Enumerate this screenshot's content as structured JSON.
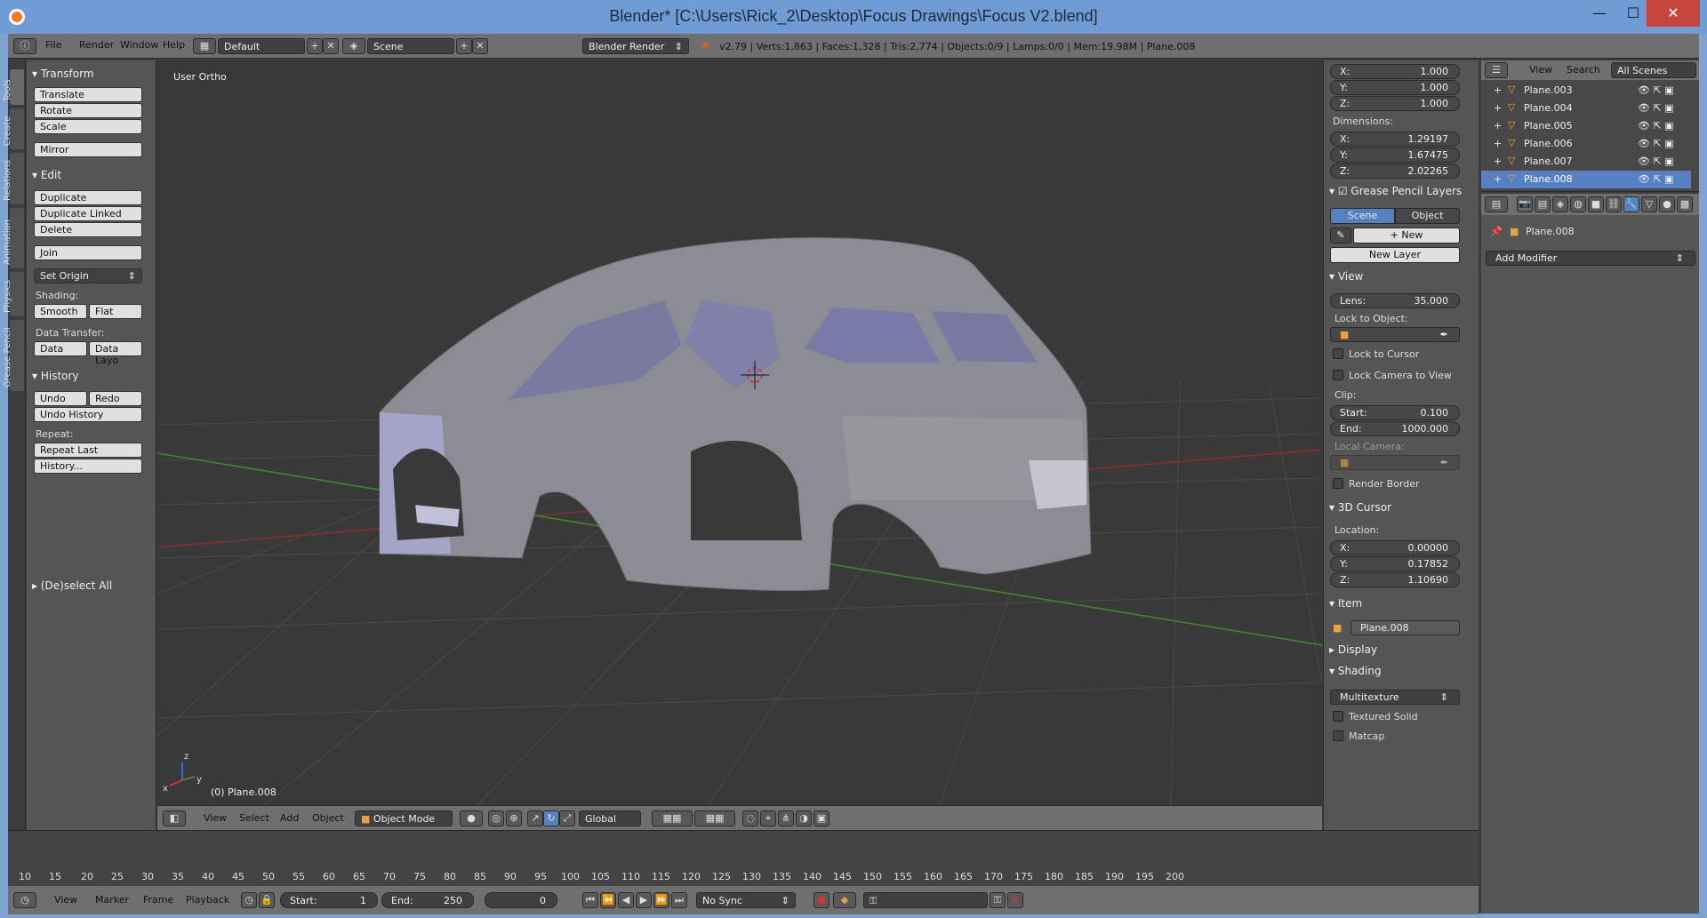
{
  "window": {
    "title": "Blender* [C:\\Users\\Rick_2\\Desktop\\Focus Drawings\\Focus V2.blend]",
    "min_glyph": "—",
    "max_glyph": "☐",
    "close_glyph": "✕"
  },
  "info_header": {
    "menus": [
      "File",
      "Render",
      "Window",
      "Help"
    ],
    "layout": "Default",
    "scene": "Scene",
    "engine": "Blender Render",
    "stats": "v2.79 | Verts:1,863 | Faces:1,328 | Tris:2,774 | Objects:0/9 | Lamps:0/0 | Mem:19.98M | Plane.008"
  },
  "left_tabs": [
    "Tools",
    "Create",
    "Relations",
    "Animation",
    "Physics",
    "Grease Pencil"
  ],
  "tool_shelf": {
    "transform": {
      "title": "Transform",
      "translate": "Translate",
      "rotate": "Rotate",
      "scale": "Scale",
      "mirror": "Mirror"
    },
    "edit": {
      "title": "Edit",
      "duplicate": "Duplicate",
      "duplicate_linked": "Duplicate Linked",
      "delete": "Delete",
      "join": "Join",
      "set_origin": "Set Origin"
    },
    "shading": {
      "label": "Shading:",
      "smooth": "Smooth",
      "flat": "Flat"
    },
    "data_transfer": {
      "label": "Data Transfer:",
      "data": "Data",
      "data_layo": "Data Layo"
    },
    "history": {
      "title": "History",
      "undo": "Undo",
      "redo": "Redo",
      "undo_history": "Undo History",
      "repeat_label": "Repeat:",
      "repeat_last": "Repeat Last",
      "history_btn": "History..."
    },
    "deselect_all": "(De)select All"
  },
  "viewport": {
    "view_label": "User Ortho",
    "object_label": "(0) Plane.008",
    "axis_labels": {
      "x": "x",
      "y": "y",
      "z": "z"
    }
  },
  "viewport_header": {
    "menus": [
      "View",
      "Select",
      "Add",
      "Object"
    ],
    "mode": "Object Mode",
    "orientation": "Global"
  },
  "n_panel": {
    "scale": {
      "x_label": "X:",
      "x": "1.000",
      "y_label": "Y:",
      "y": "1.000",
      "z_label": "Z:",
      "z": "1.000"
    },
    "dimensions": {
      "label": "Dimensions:",
      "x_label": "X:",
      "x": "1.29197",
      "y_label": "Y:",
      "y": "1.67475",
      "z_label": "Z:",
      "z": "2.02265"
    },
    "grease_pencil": {
      "title": "Grease Pencil Layers",
      "scene": "Scene",
      "object": "Object",
      "new": "New",
      "new_layer": "New Layer"
    },
    "view": {
      "title": "View",
      "lens_label": "Lens:",
      "lens": "35.000",
      "lock_to_object": "Lock to Object:",
      "lock_to_cursor": "Lock to Cursor",
      "lock_camera": "Lock Camera to View",
      "clip_label": "Clip:",
      "start_label": "Start:",
      "start": "0.100",
      "end_label": "End:",
      "end": "1000.000",
      "local_camera": "Local Camera:",
      "render_border": "Render Border"
    },
    "cursor": {
      "title": "3D Cursor",
      "location": "Location:",
      "x_label": "X:",
      "x": "0.00000",
      "y_label": "Y:",
      "y": "0.17852",
      "z_label": "Z:",
      "z": "1.10690"
    },
    "item": {
      "title": "Item",
      "name": "Plane.008"
    },
    "display": {
      "title": "Display"
    },
    "shading": {
      "title": "Shading",
      "mode": "Multitexture",
      "textured_solid": "Textured Solid",
      "matcap": "Matcap"
    }
  },
  "outliner": {
    "menus": [
      "View",
      "Search"
    ],
    "scene_filter": "All Scenes",
    "rows": [
      {
        "name": "Plane.003",
        "selected": false
      },
      {
        "name": "Plane.004",
        "selected": false
      },
      {
        "name": "Plane.005",
        "selected": false
      },
      {
        "name": "Plane.006",
        "selected": false
      },
      {
        "name": "Plane.007",
        "selected": false
      },
      {
        "name": "Plane.008",
        "selected": true
      }
    ]
  },
  "properties": {
    "object_name": "Plane.008",
    "add_modifier": "Add Modifier"
  },
  "timeline": {
    "ticks": [
      "10",
      "15",
      "20",
      "25",
      "30",
      "35",
      "40",
      "45",
      "50",
      "55",
      "60",
      "65",
      "70",
      "75",
      "80",
      "85",
      "90",
      "95",
      "100",
      "105",
      "110",
      "115",
      "120",
      "125",
      "130",
      "135",
      "140",
      "145",
      "150",
      "155",
      "160",
      "165",
      "170",
      "175",
      "180",
      "185",
      "190",
      "195",
      "200"
    ],
    "menus": [
      "View",
      "Marker",
      "Frame",
      "Playback"
    ],
    "start_label": "Start:",
    "start": "1",
    "end_label": "End:",
    "end": "250",
    "current": "0",
    "sync": "No Sync"
  },
  "colors": {
    "accent_blue": "#5680c2",
    "header_gray": "#6f6f6f",
    "viewport_bg": "#393939",
    "x_axis": "#9a3030",
    "y_axis": "#3f8a2a",
    "selected_outline": "#f0a030"
  }
}
